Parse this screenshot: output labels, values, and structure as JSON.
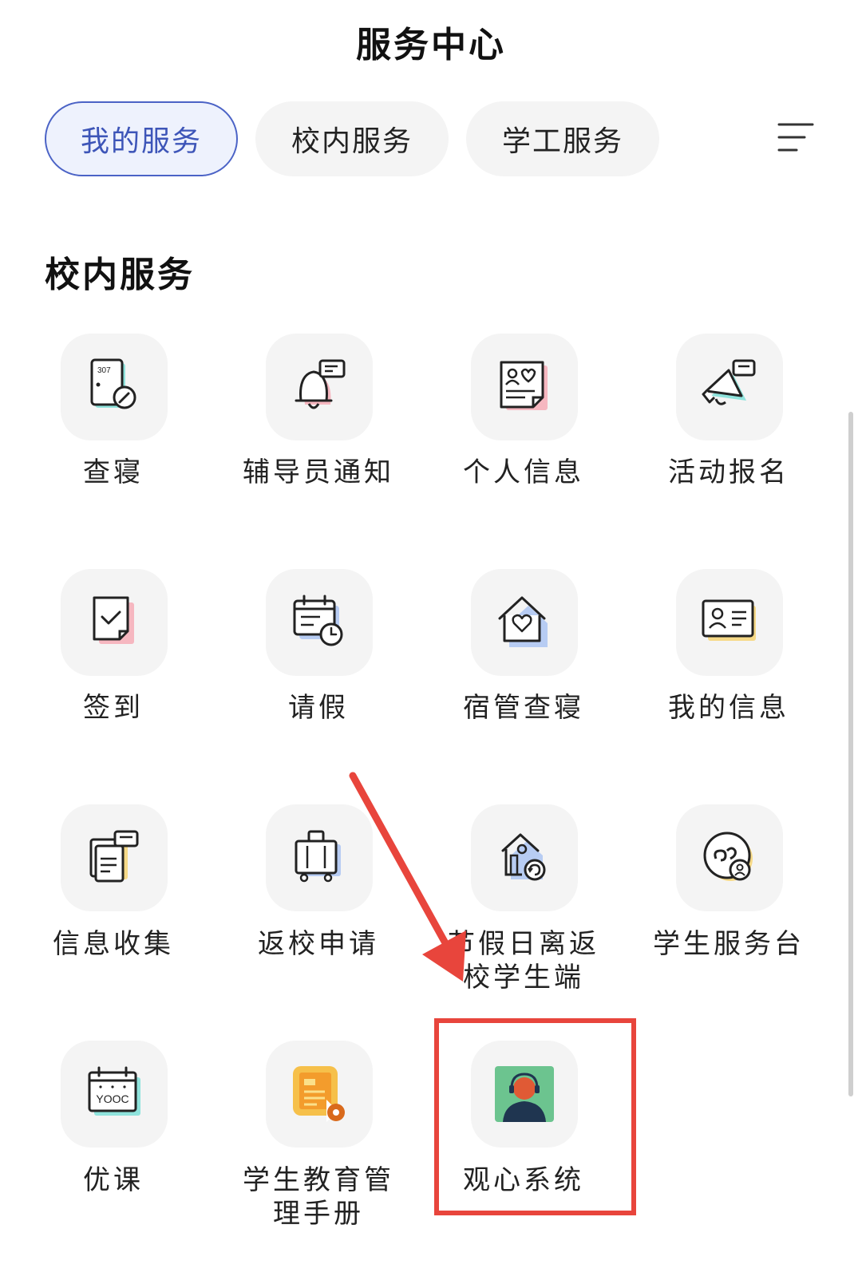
{
  "header": {
    "title": "服务中心"
  },
  "tabs": [
    {
      "label": "我的服务",
      "active": true
    },
    {
      "label": "校内服务",
      "active": false
    },
    {
      "label": "学工服务",
      "active": false
    }
  ],
  "section": {
    "title": "校内服务"
  },
  "services": [
    {
      "label": "查寝",
      "icon": "door-check-icon",
      "room_number": "307"
    },
    {
      "label": "辅导员通知",
      "icon": "bell-message-icon"
    },
    {
      "label": "个人信息",
      "icon": "profile-card-icon"
    },
    {
      "label": "活动报名",
      "icon": "megaphone-icon"
    },
    {
      "label": "签到",
      "icon": "checkbox-sign-icon"
    },
    {
      "label": "请假",
      "icon": "calendar-clock-icon"
    },
    {
      "label": "宿管查寝",
      "icon": "house-heart-icon"
    },
    {
      "label": "我的信息",
      "icon": "id-card-icon"
    },
    {
      "label": "信息收集",
      "icon": "documents-chat-icon"
    },
    {
      "label": "返校申请",
      "icon": "luggage-icon"
    },
    {
      "label": "节假日离返校学生端",
      "label_line1": "节假日离返",
      "label_line2": "校学生端",
      "icon": "home-return-icon"
    },
    {
      "label": "学生服务台",
      "icon": "service-desk-icon"
    },
    {
      "label": "优课",
      "icon": "yooc-calendar-icon",
      "icon_text": "YOOC"
    },
    {
      "label": "学生教育管理手册",
      "label_line1": "学生教育管",
      "label_line2": "理手册",
      "icon": "manual-gear-icon"
    },
    {
      "label": "观心系统",
      "icon": "headset-person-icon"
    }
  ],
  "colors": {
    "active_tab_border": "#4b63c6",
    "active_tab_bg": "#eef2fd",
    "annotation_red": "#e8453c",
    "accent_teal": "#8fe3dc",
    "accent_pink": "#f6b7c0",
    "accent_yellow": "#f6d987",
    "accent_blue": "#b7ccf3"
  }
}
